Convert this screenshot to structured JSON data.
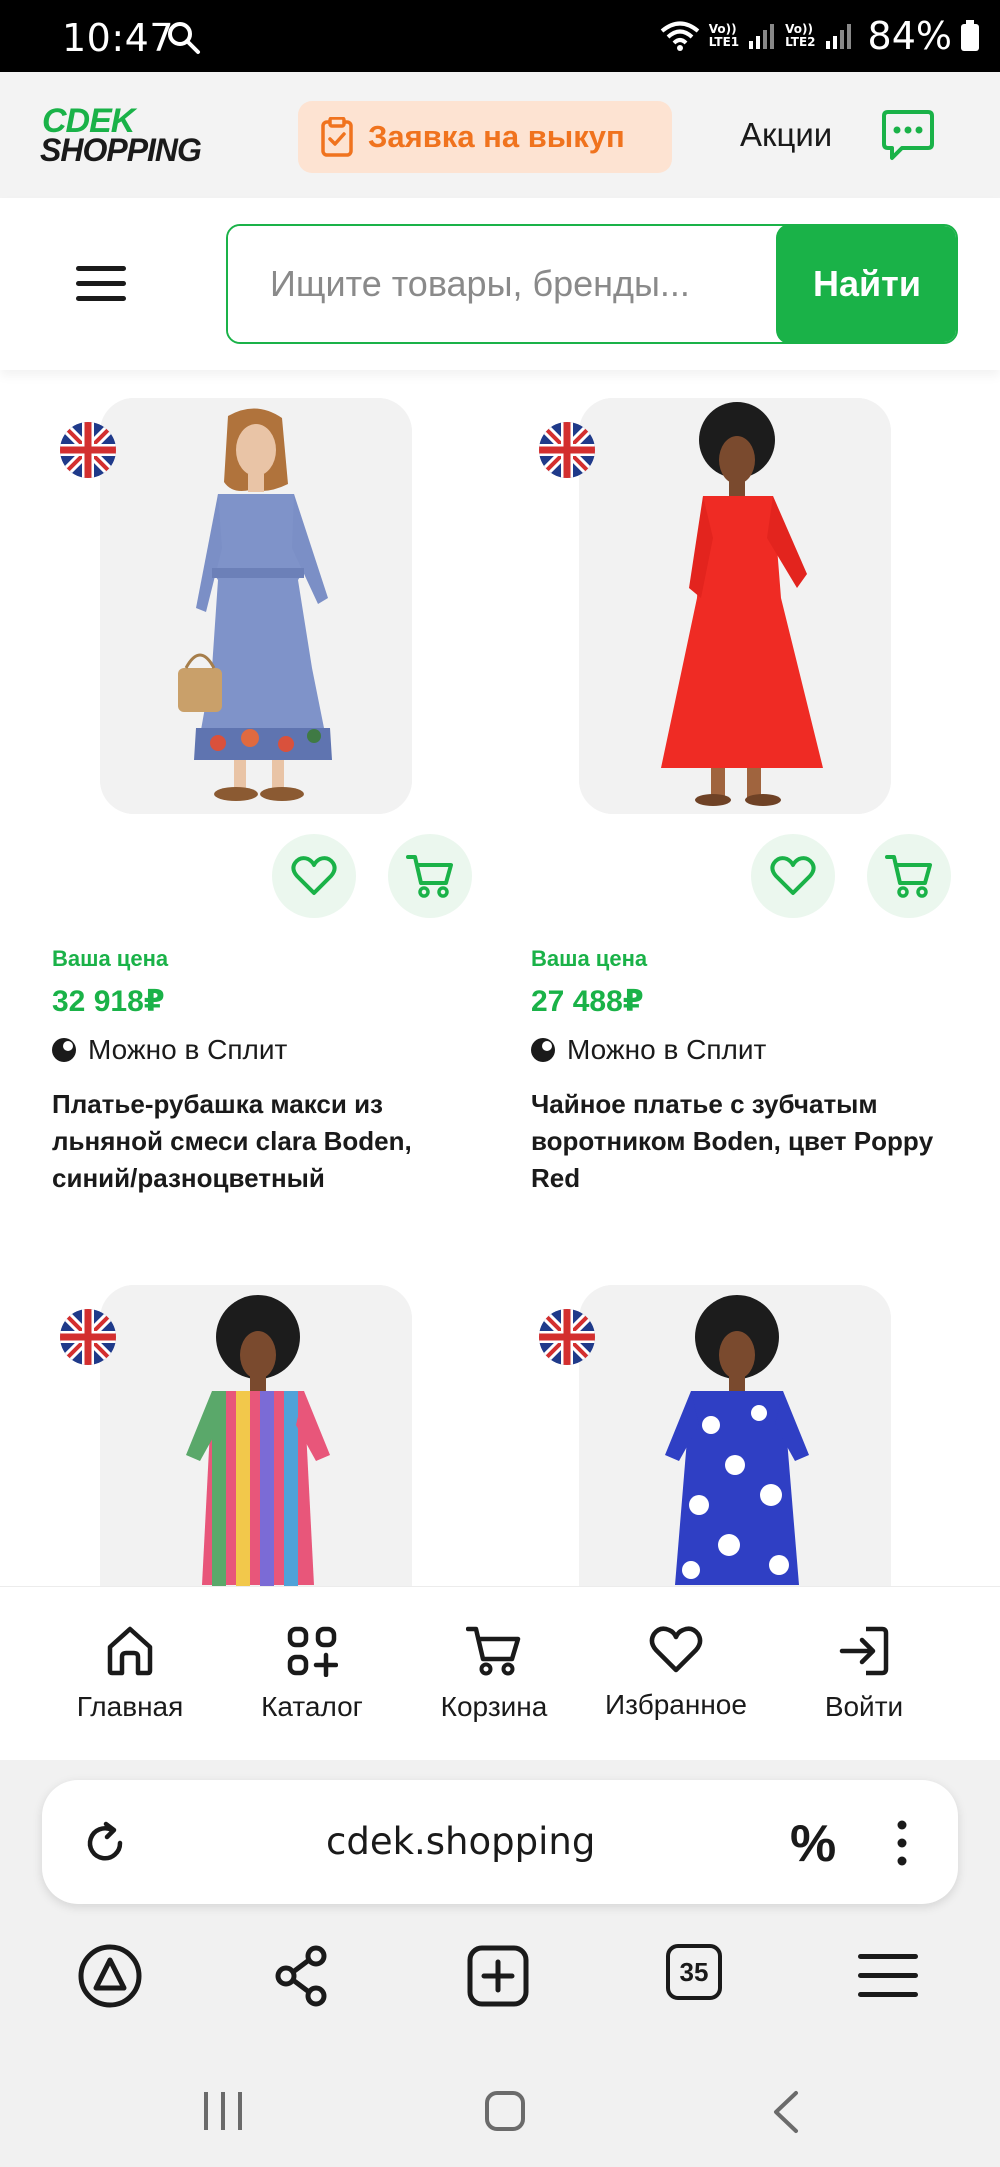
{
  "status_bar": {
    "time": "10:47",
    "sim1": "LTE1",
    "sim2": "LTE2",
    "volte1": "Vo))",
    "volte2": "Vo))",
    "battery": "84%"
  },
  "header": {
    "logo_line1": "CDEK",
    "logo_line2": "SHOPPING",
    "buyout_label": "Заявка на выкуп",
    "promo_label": "Акции"
  },
  "search": {
    "placeholder": "Ищите товары, бренды...",
    "button_label": "Найти"
  },
  "products": [
    {
      "price_label": "Ваша цена",
      "price": "32 918₽",
      "split": "Можно в Сплит",
      "title": "Платье-рубашка макси из льняной смеси clara Boden, синий/разноцветный"
    },
    {
      "price_label": "Ваша цена",
      "price": "27 488₽",
      "split": "Можно в Сплит",
      "title": "Чайное платье с зубчатым воротником Boden, цвет Poppy Red"
    }
  ],
  "bottom_nav": {
    "items": [
      {
        "label": "Главная"
      },
      {
        "label": "Каталог"
      },
      {
        "label": "Корзина"
      },
      {
        "label": "Избранное"
      },
      {
        "label": "Войти"
      }
    ]
  },
  "browser": {
    "url": "cdek.shopping",
    "tabs_count": "35",
    "percent_symbol": "%"
  },
  "colors": {
    "brand_green": "#1ab248",
    "accent_orange": "#f0731e",
    "accent_orange_bg": "#fde3d2"
  }
}
